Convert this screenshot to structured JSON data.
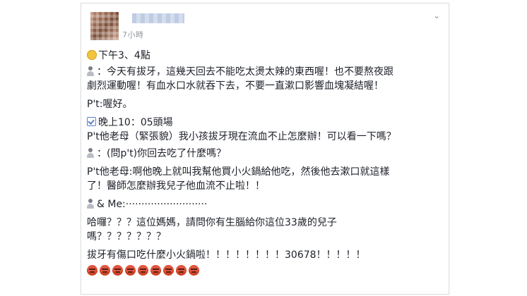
{
  "post": {
    "time_label": "7小時",
    "lines": [
      "下午3、4點",
      "：今天有拔牙，這幾天回去不能吃太燙太辣的東西喔！也不要熬夜跟",
      "劇烈運動喔！有血水口水就吞下去，不要一直漱口影響血塊凝結喔！",
      "P't:喔好。",
      "晚上10：05頭場",
      "P't他老母（緊張貌）我小孩拔牙現在流血不止怎麼辦！可以看一下嗎？",
      "：(問p't)你回去吃了什麼嗎？",
      "P't他老母:啊他晚上就叫我幫他買小火鍋給他吃，然後他去漱口就這樣",
      "了！醫師怎麼辦我兒子他血流不止啦！！",
      "& Me:··························",
      "哈囉？？？這位媽媽，請問你有生腦給你這位33歲的兒子",
      "嗎？？？？？？？",
      "拔牙有傷口吃什麼小火鍋啦！！！！！！！！30678！！！！！"
    ]
  },
  "icons": {
    "menu": "chevron-down-icon",
    "face": "smile-emoji-icon",
    "doctor": "person-icon",
    "clock": "checkbox-icon",
    "angry_count": 9
  },
  "colors": {
    "text": "#1d2129",
    "meta": "#90949c",
    "name_blur": "#b9c6e0",
    "angry_emoji": "#e0553f"
  }
}
